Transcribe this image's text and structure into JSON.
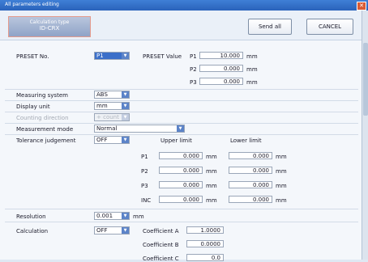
{
  "window": {
    "title": "All parameters editing"
  },
  "toolbar": {
    "calc_type_label": "Calculation type",
    "calc_type_value": "ID-CRX",
    "send_all": "Send all",
    "cancel": "CANCEL"
  },
  "preset": {
    "label": "PRESET No.",
    "value": "P1",
    "value_label": "PRESET Value",
    "rows": [
      {
        "name": "P1",
        "value": "10.000",
        "unit": "mm"
      },
      {
        "name": "P2",
        "value": "0.000",
        "unit": "mm"
      },
      {
        "name": "P3",
        "value": "0.000",
        "unit": "mm"
      }
    ]
  },
  "measuring_system": {
    "label": "Measuring system",
    "value": "ABS"
  },
  "display_unit": {
    "label": "Display unit",
    "value": "mm"
  },
  "counting_direction": {
    "label": "Counting direction",
    "value": "+ count"
  },
  "measurement_mode": {
    "label": "Measurement mode",
    "value": "Normal"
  },
  "tolerance": {
    "label": "Tolerance judgement",
    "value": "OFF",
    "upper_label": "Upper limit",
    "lower_label": "Lower limit",
    "rows": [
      {
        "name": "P1",
        "upper": "0.000",
        "lower": "0.000",
        "unit": "mm"
      },
      {
        "name": "P2",
        "upper": "0.000",
        "lower": "0.000",
        "unit": "mm"
      },
      {
        "name": "P3",
        "upper": "0.000",
        "lower": "0.000",
        "unit": "mm"
      },
      {
        "name": "INC",
        "upper": "0.000",
        "lower": "0.000",
        "unit": "mm"
      }
    ]
  },
  "resolution": {
    "label": "Resolution",
    "value": "0.001",
    "unit": "mm"
  },
  "calculation": {
    "label": "Calculation",
    "value": "OFF",
    "coefficients": [
      {
        "label": "Coefficient A",
        "value": "1.0000"
      },
      {
        "label": "Coefficient B",
        "value": "0.0000"
      },
      {
        "label": "Coefficient C",
        "value": "0.0"
      }
    ]
  },
  "icons": {
    "close": "close-icon",
    "dropdown": "chevron-down-icon"
  }
}
